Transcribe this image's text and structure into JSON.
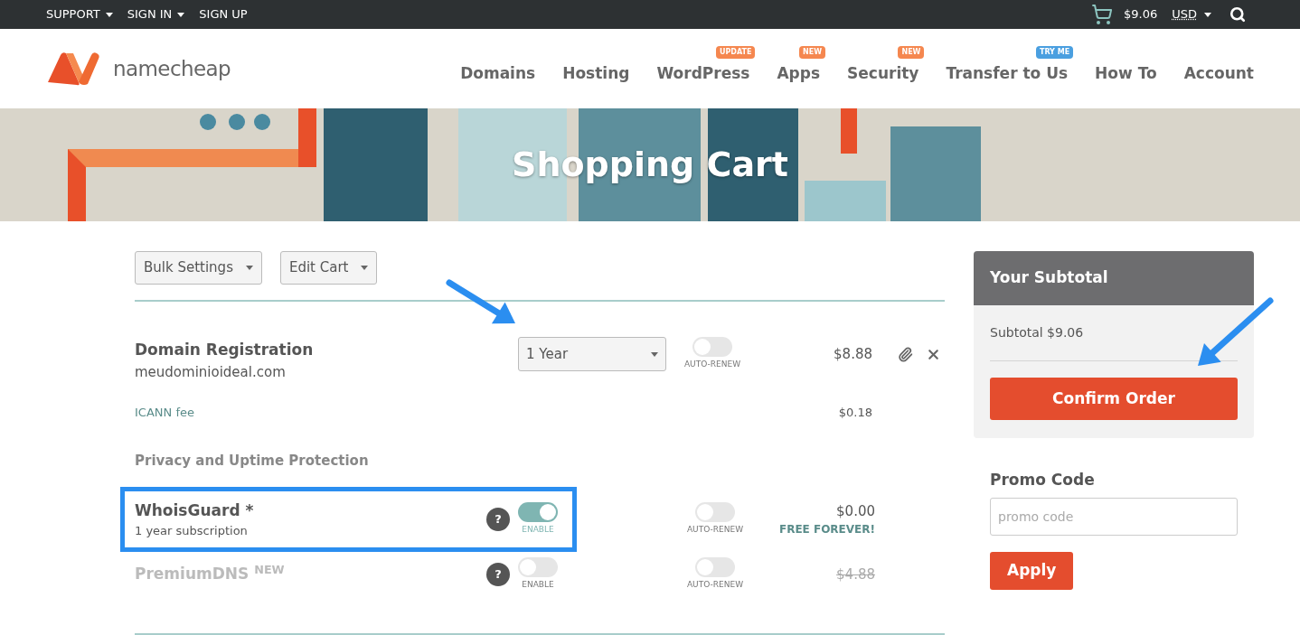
{
  "top_bar": {
    "links": [
      {
        "label": "SUPPORT",
        "has_menu": true
      },
      {
        "label": "SIGN IN",
        "has_menu": true
      },
      {
        "label": "SIGN UP",
        "has_menu": false
      }
    ],
    "cart_total": "$9.06",
    "currency": "USD"
  },
  "header": {
    "logo_text": "namecheap",
    "nav": [
      {
        "label": "Domains"
      },
      {
        "label": "Hosting"
      },
      {
        "label": "WordPress",
        "badge": "UPDATE",
        "color": "#f5874f"
      },
      {
        "label": "Apps",
        "badge": "NEW",
        "color": "#f5874f"
      },
      {
        "label": "Security",
        "badge": "NEW",
        "color": "#f5874f"
      },
      {
        "label": "Transfer to Us",
        "badge": "TRY ME",
        "color": "#4a9fe0"
      },
      {
        "label": "How To"
      },
      {
        "label": "Account"
      }
    ]
  },
  "banner": {
    "title": "Shopping Cart"
  },
  "toolbar": [
    "Bulk Settings",
    "Edit Cart"
  ],
  "cart": {
    "item": {
      "title": "Domain Registration",
      "domain": "meudominioideal.com",
      "period": "1 Year",
      "auto_renew": {
        "on": false,
        "label": "AUTO-RENEW"
      },
      "price": "$8.88"
    },
    "fee": {
      "label": "ICANN fee",
      "price": "$0.18"
    },
    "section_title": "Privacy and Uptime Protection",
    "addons": [
      {
        "name": "WhoisGuard *",
        "subtitle": "1 year subscription",
        "help": "?",
        "disabled": false,
        "highlighted": true,
        "enable": {
          "on": true,
          "label": "ENABLE"
        },
        "auto_renew": {
          "on": false,
          "label": "AUTO-RENEW"
        },
        "price": "$0.00",
        "struck": false,
        "note": "FREE FOREVER!"
      },
      {
        "name": "PremiumDNS $^{NEW}$",
        "help": "?",
        "disabled": true,
        "highlighted": false,
        "enable": {
          "on": false,
          "label": "ENABLE"
        },
        "auto_renew": {
          "on": false,
          "label": "AUTO-RENEW"
        },
        "price": "$4.88",
        "struck": true
      }
    ]
  },
  "summary": {
    "title": "Your Subtotal",
    "subtotal": "Subtotal $9.06",
    "confirm": "Confirm Order"
  },
  "promo": {
    "label": "Promo Code",
    "placeholder": "promo code",
    "apply": "Apply"
  }
}
